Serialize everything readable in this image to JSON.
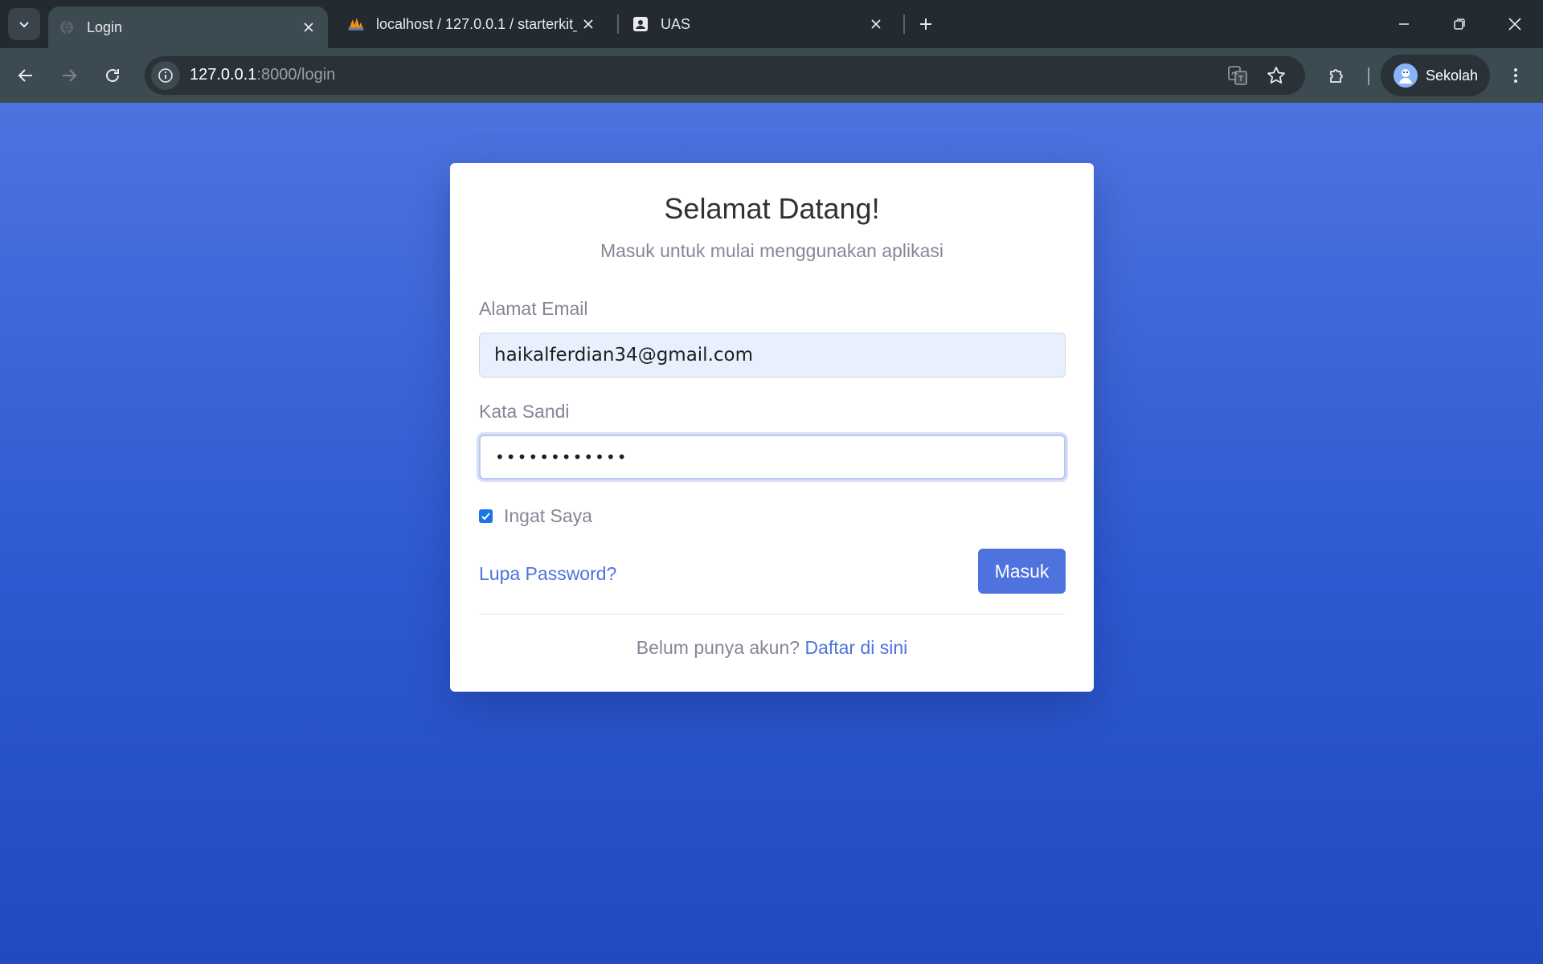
{
  "browser": {
    "tabs": [
      {
        "title": "Login",
        "active": true,
        "favicon": "globe-icon"
      },
      {
        "title": "localhost / 127.0.0.1 / starterkit_",
        "active": false,
        "favicon": "phpmyadmin-icon"
      },
      {
        "title": "UAS",
        "active": false,
        "favicon": "contact-card-icon"
      }
    ],
    "url_host": "127.0.0.1",
    "url_path": ":8000/login",
    "profile_name": "Sekolah"
  },
  "login": {
    "title": "Selamat Datang!",
    "subtitle": "Masuk untuk mulai menggunakan aplikasi",
    "email_label": "Alamat Email",
    "email_value": "haikalferdian34@gmail.com",
    "password_label": "Kata Sandi",
    "password_value": "••••••••••••",
    "remember_label": "Ingat Saya",
    "remember_checked": true,
    "forgot_label": "Lupa Password?",
    "submit_label": "Masuk",
    "footer_prompt": "Belum punya akun?",
    "footer_link": "Daftar di sini"
  },
  "colors": {
    "primary": "#4e73df",
    "gradient_top": "#4e73df",
    "gradient_bottom": "#224abe",
    "muted_text": "#858796",
    "autofill_bg": "#e8f0fe"
  }
}
